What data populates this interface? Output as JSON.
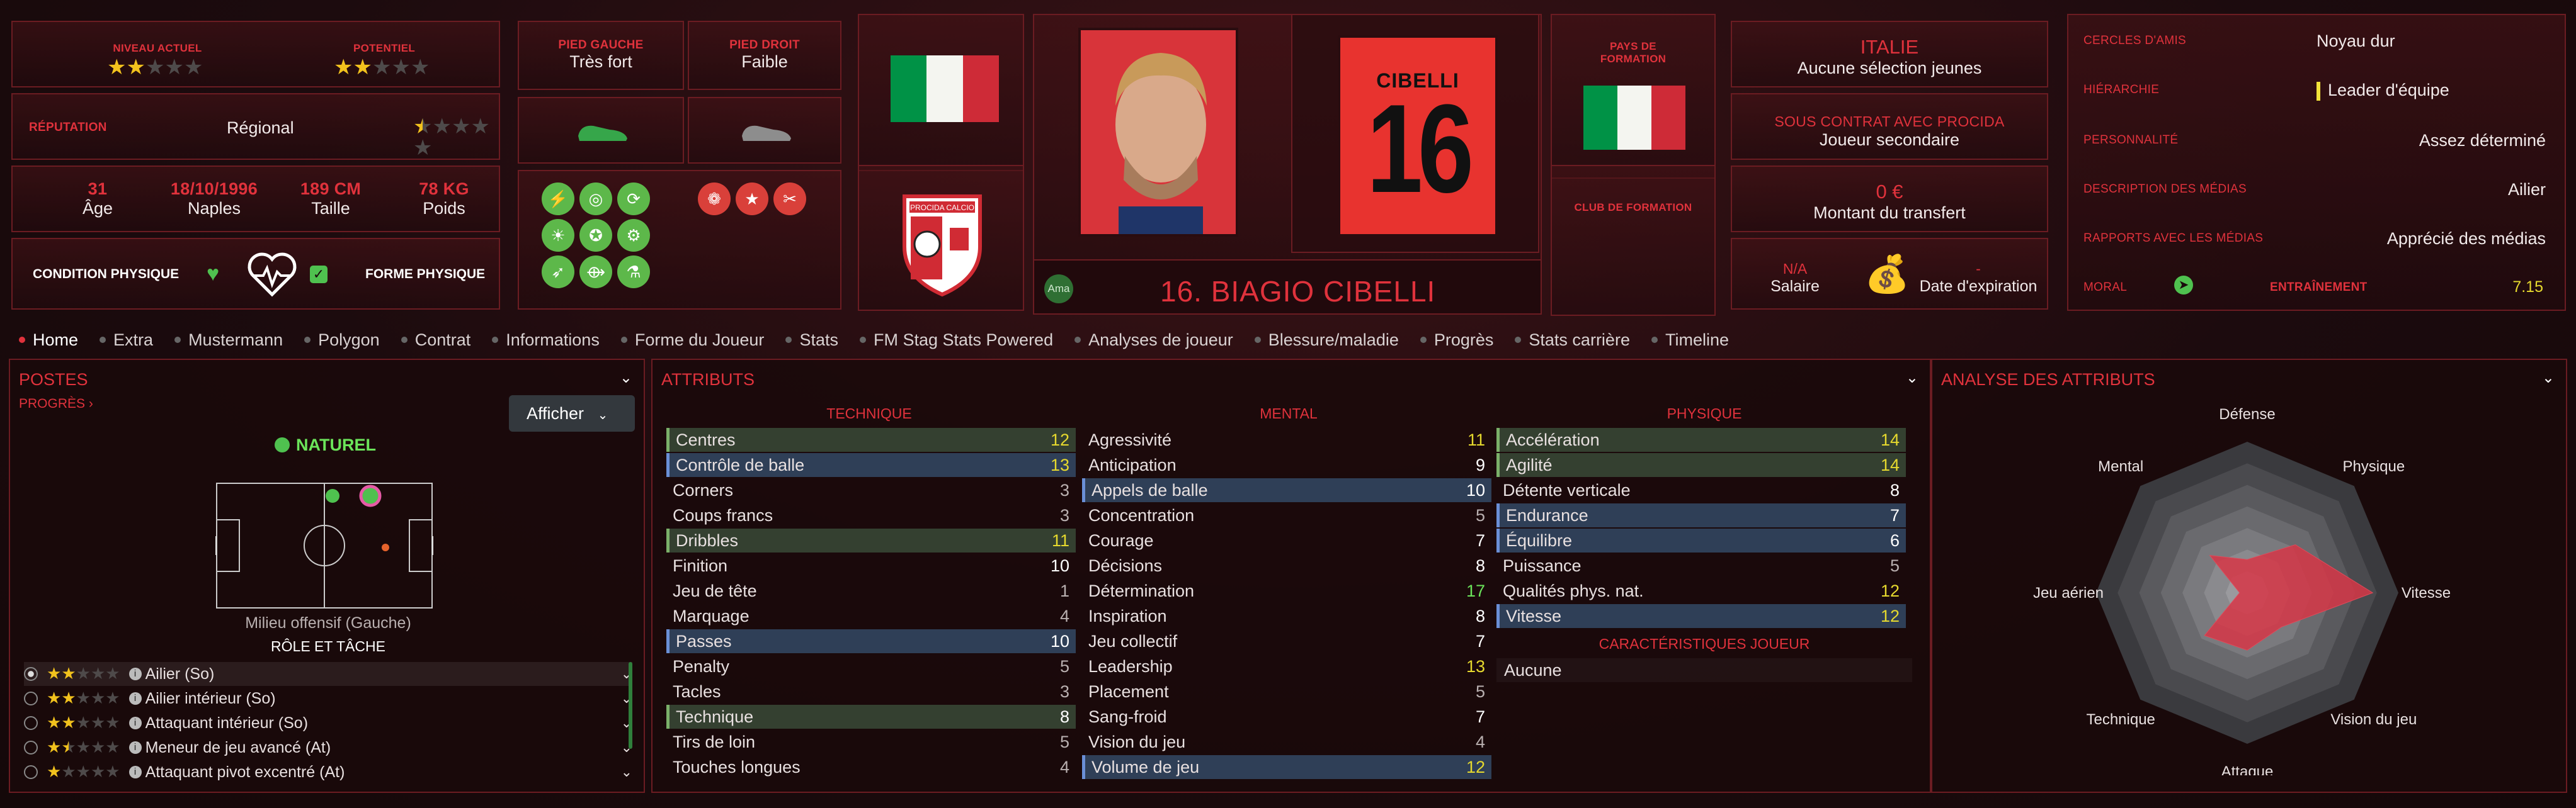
{
  "header": {
    "level_label": "NIVEAU ACTUEL",
    "level_stars": 2,
    "potential_label": "POTENTIEL",
    "potential_stars": 2,
    "reputation_label": "RÉPUTATION",
    "reputation_value": "Régional",
    "reputation_stars": 0.5,
    "age": "31",
    "age_label": "Âge",
    "birth": "18/10/1996",
    "birth_label": "Naples",
    "height": "189 CM",
    "height_label": "Taille",
    "weight": "78 KG",
    "weight_label": "Poids",
    "condition_label": "CONDITION PHYSIQUE",
    "form_label": "FORME PHYSIQUE",
    "left_foot_label": "PIED GAUCHE",
    "left_foot_value": "Très fort",
    "right_foot_label": "PIED DROIT",
    "right_foot_value": "Faible",
    "club_crest_text": "PROCIDA CALCIO",
    "shirt_name": "CIBELLI",
    "shirt_number": "16",
    "player_name": "16. BIAGIO CIBELLI",
    "badge": "Ama",
    "formation_country_label": "PAYS DE FORMATION",
    "formation_club_label": "CLUB DE FORMATION",
    "nation": "ITALIE",
    "nation_sub": "Aucune sélection jeunes",
    "contract_label": "SOUS CONTRAT AVEC PROCIDA",
    "contract_value": "Joueur secondaire",
    "transfer_value": "0 €",
    "transfer_label": "Montant du transfert",
    "salary_value": "N/A",
    "salary_label": "Salaire",
    "expiry_value": "-",
    "expiry_label": "Date d'expiration",
    "friends_label": "CERCLES D'AMIS",
    "friends_value": "Noyau dur",
    "hierarchy_label": "HIÉRARCHIE",
    "hierarchy_value": "Leader d'équipe",
    "personality_label": "PERSONNALITÉ",
    "personality_value": "Assez déterminé",
    "media_desc_label": "DESCRIPTION DES MÉDIAS",
    "media_desc_value": "Ailier",
    "media_rel_label": "RAPPORTS AVEC LES MÉDIAS",
    "media_rel_value": "Apprécié des médias",
    "morale_label": "MORAL",
    "training_label": "ENTRAÎNEMENT",
    "training_value": "7.15",
    "colors": {
      "accent": "#e0323c",
      "italy_green": "#009246",
      "italy_red": "#ce2b37",
      "ok_green": "#4fc14f"
    }
  },
  "tabs": [
    "Home",
    "Extra",
    "Mustermann",
    "Polygon",
    "Contrat",
    "Informations",
    "Forme du Joueur",
    "Stats",
    "FM Stag Stats Powered",
    "Analyses de joueur",
    "Blessure/maladie",
    "Progrès",
    "Stats carrière",
    "Timeline"
  ],
  "positions": {
    "title": "POSTES",
    "progress": "PROGRÈS",
    "show_button": "Afficher",
    "natural": "NATUREL",
    "position_name": "Milieu offensif (Gauche)",
    "role_title": "RÔLE ET TÂCHE",
    "roles": [
      {
        "name": "Ailier (So)",
        "stars": 2
      },
      {
        "name": "Ailier intérieur (So)",
        "stars": 2
      },
      {
        "name": "Attaquant intérieur (So)",
        "stars": 2
      },
      {
        "name": "Meneur de jeu avancé (At)",
        "stars": 1.5
      },
      {
        "name": "Attaquant pivot excentré (At)",
        "stars": 1
      }
    ]
  },
  "attributes": {
    "title": "ATTRIBUTS",
    "tech_title": "TECHNIQUE",
    "mental_title": "MENTAL",
    "phys_title": "PHYSIQUE",
    "traits_title": "CARACTÉRISTIQUES JOUEUR",
    "traits_value": "Aucune",
    "technique": [
      {
        "name": "Centres",
        "value": "12",
        "color": "yellow",
        "hl": "g"
      },
      {
        "name": "Contrôle de balle",
        "value": "13",
        "color": "yellow",
        "hl": "b"
      },
      {
        "name": "Corners",
        "value": "3",
        "color": "grey",
        "hl": ""
      },
      {
        "name": "Coups francs",
        "value": "3",
        "color": "grey",
        "hl": ""
      },
      {
        "name": "Dribbles",
        "value": "11",
        "color": "yellow",
        "hl": "g"
      },
      {
        "name": "Finition",
        "value": "10",
        "color": "white",
        "hl": ""
      },
      {
        "name": "Jeu de tête",
        "value": "1",
        "color": "grey",
        "hl": ""
      },
      {
        "name": "Marquage",
        "value": "4",
        "color": "grey",
        "hl": ""
      },
      {
        "name": "Passes",
        "value": "10",
        "color": "white",
        "hl": "b"
      },
      {
        "name": "Penalty",
        "value": "5",
        "color": "grey",
        "hl": ""
      },
      {
        "name": "Tacles",
        "value": "3",
        "color": "grey",
        "hl": ""
      },
      {
        "name": "Technique",
        "value": "8",
        "color": "white",
        "hl": "g"
      },
      {
        "name": "Tirs de loin",
        "value": "5",
        "color": "grey",
        "hl": ""
      },
      {
        "name": "Touches longues",
        "value": "4",
        "color": "grey",
        "hl": ""
      }
    ],
    "mental": [
      {
        "name": "Agressivité",
        "value": "11",
        "color": "yellow",
        "hl": ""
      },
      {
        "name": "Anticipation",
        "value": "9",
        "color": "white",
        "hl": ""
      },
      {
        "name": "Appels de balle",
        "value": "10",
        "color": "white",
        "hl": "b"
      },
      {
        "name": "Concentration",
        "value": "5",
        "color": "grey",
        "hl": ""
      },
      {
        "name": "Courage",
        "value": "7",
        "color": "white",
        "hl": ""
      },
      {
        "name": "Décisions",
        "value": "8",
        "color": "white",
        "hl": ""
      },
      {
        "name": "Détermination",
        "value": "17",
        "color": "green",
        "hl": ""
      },
      {
        "name": "Inspiration",
        "value": "8",
        "color": "white",
        "hl": ""
      },
      {
        "name": "Jeu collectif",
        "value": "7",
        "color": "white",
        "hl": ""
      },
      {
        "name": "Leadership",
        "value": "13",
        "color": "yellow",
        "hl": ""
      },
      {
        "name": "Placement",
        "value": "5",
        "color": "grey",
        "hl": ""
      },
      {
        "name": "Sang-froid",
        "value": "7",
        "color": "white",
        "hl": ""
      },
      {
        "name": "Vision du jeu",
        "value": "4",
        "color": "grey",
        "hl": ""
      },
      {
        "name": "Volume de jeu",
        "value": "12",
        "color": "yellow",
        "hl": "b"
      }
    ],
    "physique": [
      {
        "name": "Accélération",
        "value": "14",
        "color": "yellow",
        "hl": "g"
      },
      {
        "name": "Agilité",
        "value": "14",
        "color": "yellow",
        "hl": "g"
      },
      {
        "name": "Détente verticale",
        "value": "8",
        "color": "white",
        "hl": ""
      },
      {
        "name": "Endurance",
        "value": "7",
        "color": "white",
        "hl": "b"
      },
      {
        "name": "Équilibre",
        "value": "6",
        "color": "white",
        "hl": "b"
      },
      {
        "name": "Puissance",
        "value": "5",
        "color": "grey",
        "hl": ""
      },
      {
        "name": "Qualités phys. nat.",
        "value": "12",
        "color": "yellow",
        "hl": ""
      },
      {
        "name": "Vitesse",
        "value": "12",
        "color": "yellow",
        "hl": "b"
      }
    ]
  },
  "analysis": {
    "title": "ANALYSE DES ATTRIBUTS",
    "axes": [
      "Défense",
      "Physique",
      "Vitesse",
      "Vision du jeu",
      "Attaque",
      "Technique",
      "Jeu aérien",
      "Mental"
    ],
    "values": [
      0.22,
      0.45,
      0.83,
      0.32,
      0.38,
      0.4,
      0.05,
      0.35
    ]
  }
}
